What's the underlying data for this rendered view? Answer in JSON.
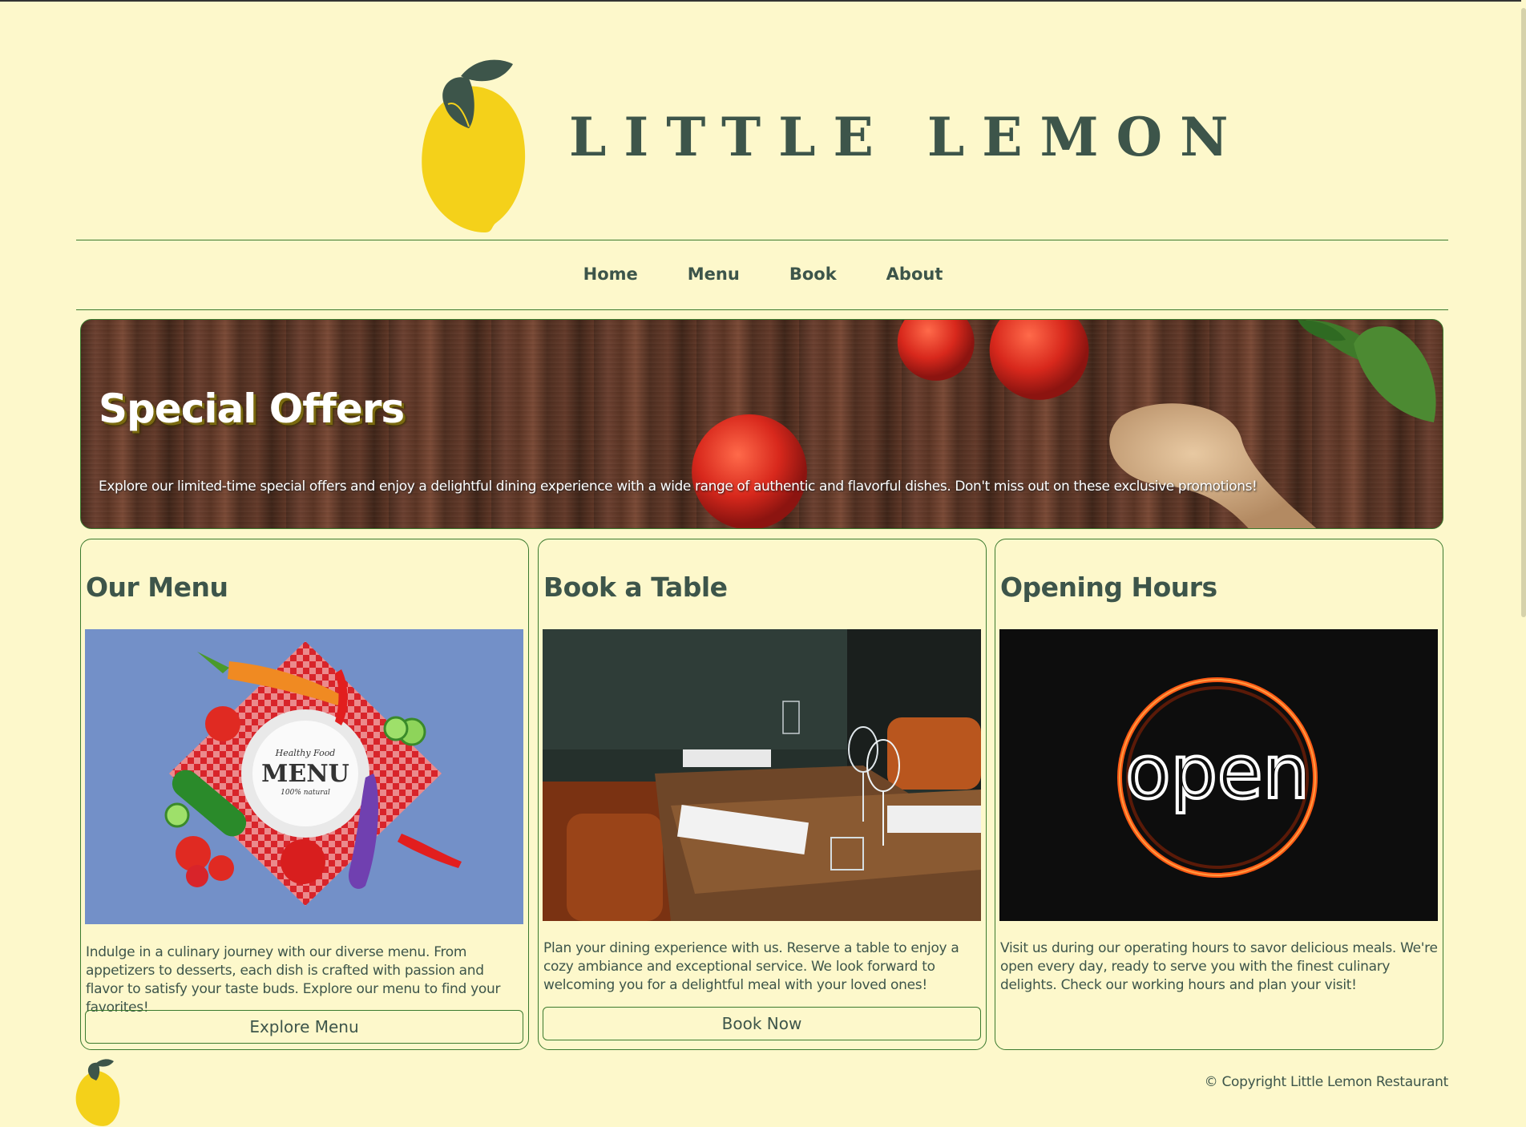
{
  "header": {
    "brand_title": "LITTLE LEMON"
  },
  "nav": {
    "items": [
      {
        "label": "Home"
      },
      {
        "label": "Menu"
      },
      {
        "label": "Book"
      },
      {
        "label": "About"
      }
    ]
  },
  "hero": {
    "title": "Special Offers",
    "text": "Explore our limited-time special offers and enjoy a delightful dining experience with a wide range of authentic and flavorful dishes. Don't miss out on these exclusive promotions!"
  },
  "cards": [
    {
      "title": "Our Menu",
      "image_alt": "menu plate illustration",
      "text": "Indulge in a culinary journey with our diverse menu. From appetizers to desserts, each dish is crafted with passion and flavor to satisfy your taste buds. Explore our menu to find your favorites!",
      "button": "Explore Menu"
    },
    {
      "title": "Book a Table",
      "image_alt": "restaurant tables",
      "text": "Plan your dining experience with us. Reserve a table to enjoy a cozy ambiance and exceptional service. We look forward to welcoming you for a delightful meal with your loved ones!",
      "button": "Book Now"
    },
    {
      "title": "Opening Hours",
      "image_alt": "neon open sign",
      "text": "Visit us during our operating hours to savor delicious meals. We're open every day, ready to serve you with the finest culinary delights. Check our working hours and plan your visit!"
    }
  ],
  "menu_image_text": {
    "line1": "Healthy Food",
    "line2": "MENU",
    "line3": "100% natural"
  },
  "open_sign_text": "open",
  "footer": {
    "copyright": "© Copyright Little Lemon Restaurant"
  },
  "colors": {
    "background": "#fdf8cb",
    "text": "#3d554a",
    "border": "#3b7a2e",
    "lemon": "#f4d11a",
    "leaf": "#3d554a"
  }
}
